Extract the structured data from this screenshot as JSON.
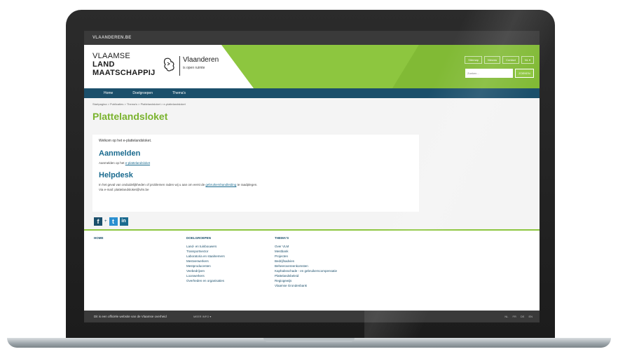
{
  "gov_bar": {
    "label": "VLAANDEREN.BE"
  },
  "header": {
    "brand_line1": "VLAAMSE",
    "brand_line2": "LAND",
    "brand_line3": "MAATSCHAPPIJ",
    "vlaanderen_name": "Vlaanderen",
    "vlaanderen_sub": "is open ruimte",
    "top_links": [
      "Sitemap",
      "Nieuws",
      "Contact",
      "NL ▾"
    ],
    "search_placeholder": "Zoeken...",
    "search_button": "ZOEKEN"
  },
  "nav": {
    "items": [
      "Home",
      "Doelgroepen",
      "Thema's"
    ]
  },
  "breadcrumb": "Startpagina > Publicaties > Thema's > Plattelandsloket > e-plattelandsloket",
  "main": {
    "title": "Plattelandsloket",
    "welcome": "Welkom op het e-plattelandsloket.",
    "section1_title": "Aanmelden",
    "section1_text": "Aanmelden op het",
    "section1_link": "e-plattelandsloket",
    "section2_title": "Helpdesk",
    "section2_text_a": "In het geval van onduidelijkheden of problemen raden wij u aan om eerst de",
    "section2_link": "gebruikershandleiding",
    "section2_text_b": "te raadplegen.",
    "section2_email": "Via e-mail: plattelandsloket@vlm.be"
  },
  "social": {
    "facebook": "f",
    "separator": "+",
    "twitter": "t",
    "linkedin": "in"
  },
  "footer": {
    "col1_title": "HOME",
    "col2_title": "DOELGROEPEN",
    "col2_items": [
      "Land- en tuinbouwers",
      "Transportsector",
      "Laboratoria en staalnemers",
      "Mestverwerkers",
      "Mestproducenten",
      "Veebedrijven",
      "Loonwerkers",
      "Overheden en organisaties"
    ],
    "col3_title": "THEMA'S",
    "col3_items": [
      "Over VLM",
      "Mestbank",
      "Projecten",
      "Bedrijfsadvies",
      "Beheerovereenkomsten",
      "Kaphabsschade - en gebruikerscompensatie",
      "Plattelandsbeleid",
      "Regiogewijs",
      "Vlaamse Grondenbank"
    ]
  },
  "bottom_bar": {
    "official_text": "Dit is een officiële website van de Vlaamse overheid",
    "more_info": "MEER INFO ▾",
    "languages": [
      "NL",
      "FR",
      "DE",
      "EN"
    ]
  }
}
